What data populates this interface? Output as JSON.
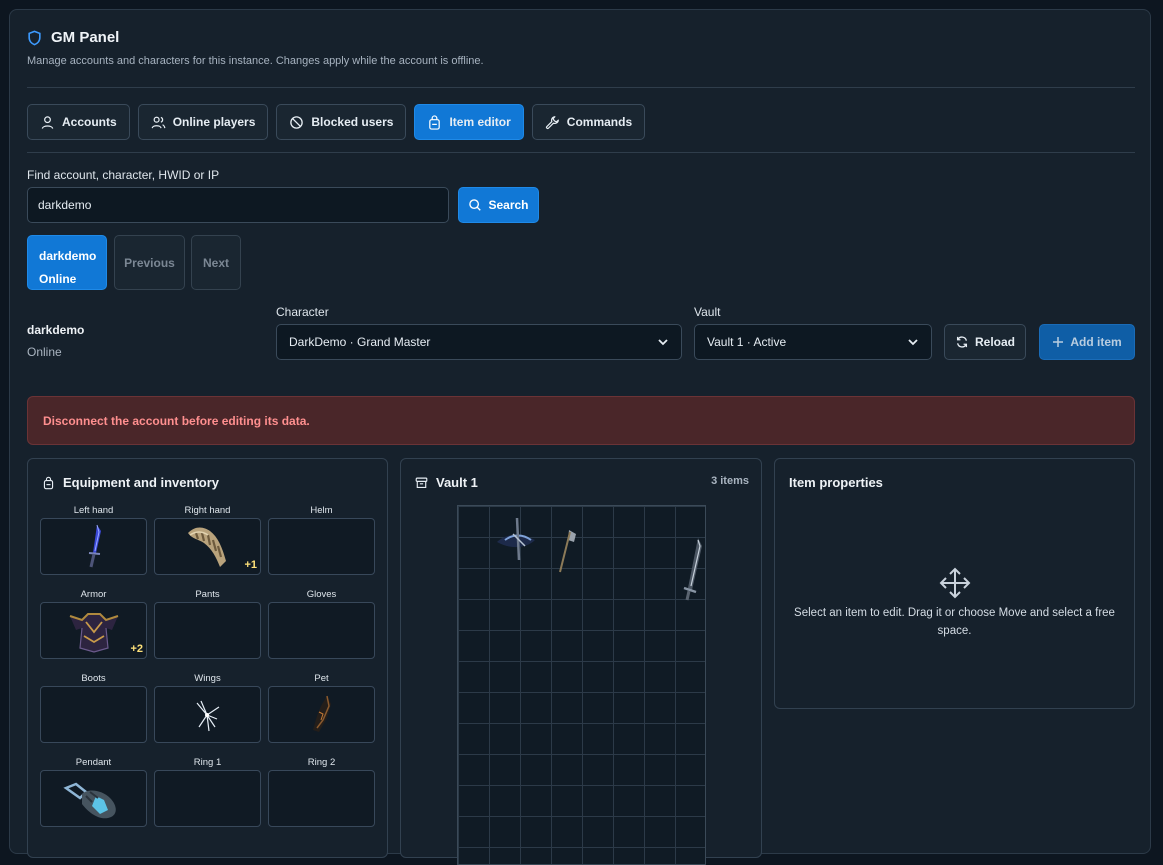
{
  "header": {
    "title": "GM Panel",
    "subtitle": "Manage accounts and characters for this instance. Changes apply while the account is offline."
  },
  "tabs": [
    {
      "label": "Accounts",
      "icon": "user-icon",
      "active": false
    },
    {
      "label": "Online players",
      "icon": "users-icon",
      "active": false
    },
    {
      "label": "Blocked users",
      "icon": "ban-icon",
      "active": false
    },
    {
      "label": "Item editor",
      "icon": "bag-icon",
      "active": true
    },
    {
      "label": "Commands",
      "icon": "wrench-icon",
      "active": false
    }
  ],
  "search": {
    "label": "Find account, character, HWID or IP",
    "value": "darkdemo",
    "button": "Search"
  },
  "results": {
    "account_name": "darkdemo",
    "account_status": "Online",
    "previous": "Previous",
    "next": "Next"
  },
  "account": {
    "name": "darkdemo",
    "status": "Online"
  },
  "character": {
    "label": "Character",
    "selected": "DarkDemo · Grand Master"
  },
  "vault": {
    "label": "Vault",
    "selected": "Vault 1 · Active"
  },
  "actions": {
    "reload": "Reload",
    "add_item": "Add item"
  },
  "alert": "Disconnect the account before editing its data.",
  "equipment": {
    "title": "Equipment and inventory",
    "slots": [
      {
        "label": "Left hand",
        "item": "blue-dagger",
        "level": ""
      },
      {
        "label": "Right hand",
        "item": "bone-shield",
        "level": "+1"
      },
      {
        "label": "Helm",
        "item": "",
        "level": ""
      },
      {
        "label": "Armor",
        "item": "dark-armor",
        "level": "+2"
      },
      {
        "label": "Pants",
        "item": "",
        "level": ""
      },
      {
        "label": "Gloves",
        "item": "",
        "level": ""
      },
      {
        "label": "Boots",
        "item": "",
        "level": ""
      },
      {
        "label": "Wings",
        "item": "white-wings",
        "level": ""
      },
      {
        "label": "Pet",
        "item": "dark-pet",
        "level": ""
      },
      {
        "label": "Pendant",
        "item": "crystal-pendant",
        "level": ""
      },
      {
        "label": "Ring 1",
        "item": "",
        "level": ""
      },
      {
        "label": "Ring 2",
        "item": "",
        "level": ""
      }
    ]
  },
  "vault_panel": {
    "title": "Vault 1",
    "count": "3 items",
    "columns": 8,
    "rows": 11,
    "items": [
      {
        "item": "crossbow",
        "col": 2,
        "row": 1
      },
      {
        "item": "axe",
        "col": 4,
        "row": 1
      },
      {
        "item": "long-sword",
        "col": 8,
        "row": 1
      }
    ]
  },
  "properties": {
    "title": "Item properties",
    "empty_text": "Select an item to edit. Drag it or choose Move and select a free space.",
    "icon": "move-icon"
  },
  "colors": {
    "accent": "#1178d6",
    "danger_bg": "#4a2629",
    "danger_text": "#ff8f8f",
    "item_level": "#ffe27a"
  }
}
